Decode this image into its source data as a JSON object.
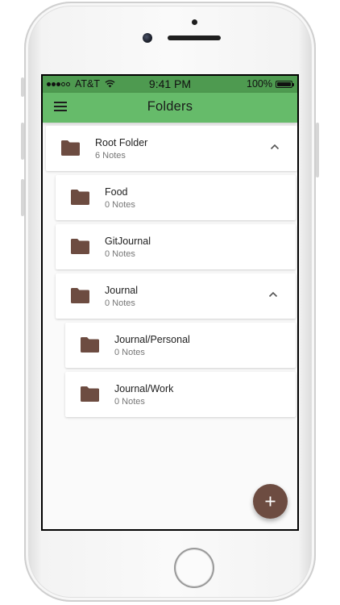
{
  "status_bar": {
    "carrier": "AT&T",
    "time": "9:41 PM",
    "battery": "100%",
    "signal_icon": "signal-dots-icon",
    "wifi_icon": "wifi-icon",
    "battery_icon": "battery-full-icon"
  },
  "app_bar": {
    "title": "Folders",
    "menu_icon": "hamburger-menu-icon"
  },
  "folders": [
    {
      "name": "Root Folder",
      "count": "6 Notes",
      "level": 0,
      "expanded": true
    },
    {
      "name": "Food",
      "count": "0 Notes",
      "level": 1,
      "expanded": null
    },
    {
      "name": "GitJournal",
      "count": "0 Notes",
      "level": 1,
      "expanded": null
    },
    {
      "name": "Journal",
      "count": "0 Notes",
      "level": 1,
      "expanded": true
    },
    {
      "name": "Journal/Personal",
      "count": "0 Notes",
      "level": 2,
      "expanded": null
    },
    {
      "name": "Journal/Work",
      "count": "0 Notes",
      "level": 2,
      "expanded": null
    }
  ],
  "fab": {
    "icon": "plus-icon"
  },
  "colors": {
    "status_bar": "#4e9a50",
    "app_bar": "#66bb6a",
    "folder_icon": "#6d4c41",
    "fab": "#6d4c41",
    "background": "#fafafa"
  }
}
